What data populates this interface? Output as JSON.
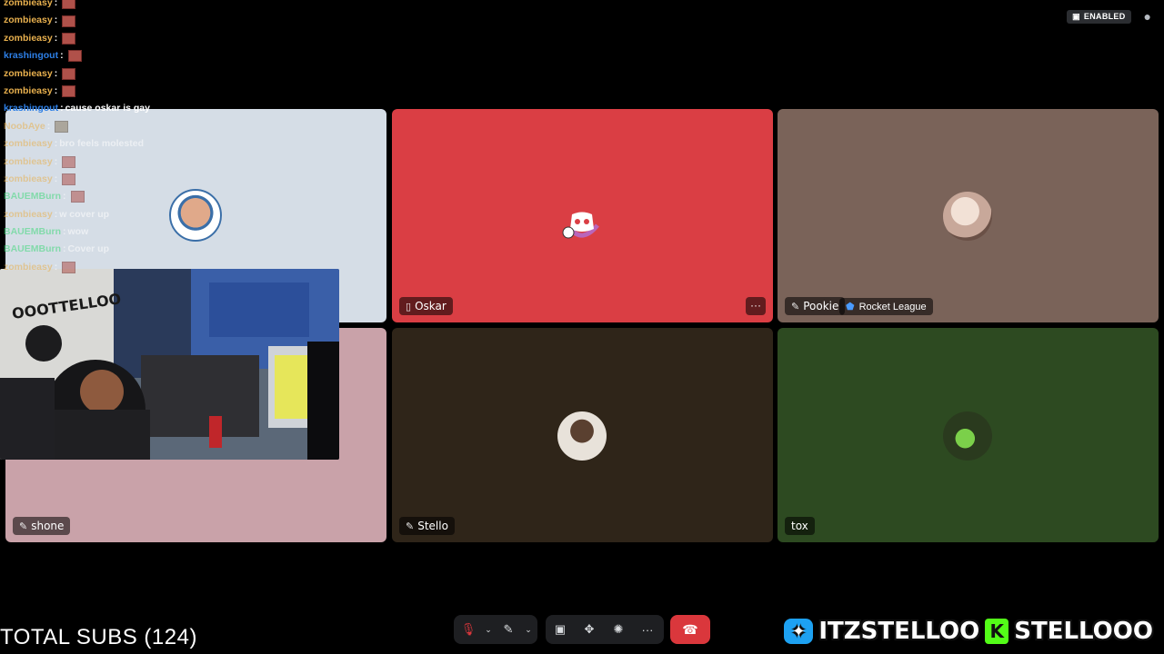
{
  "topbar": {
    "enabled_label": "ENABLED"
  },
  "chat": [
    {
      "user": "zombieasy",
      "sep": " : ",
      "msg": "",
      "emote": true,
      "color": "y",
      "dim": false
    },
    {
      "user": "zombieasy",
      "sep": " : ",
      "msg": "",
      "emote": true,
      "color": "y",
      "dim": false
    },
    {
      "user": "zombieasy",
      "sep": " : ",
      "msg": "",
      "emote": true,
      "color": "y",
      "dim": false
    },
    {
      "user": "krashingout",
      "sep": " : ",
      "msg": "",
      "emote": true,
      "color": "b",
      "dim": false
    },
    {
      "user": "zombieasy",
      "sep": " : ",
      "msg": "",
      "emote": true,
      "color": "y",
      "dim": false
    },
    {
      "user": "zombieasy",
      "sep": " : ",
      "msg": "",
      "emote": true,
      "color": "y",
      "dim": false
    },
    {
      "user": "krashingout",
      "sep": " : ",
      "msg": "cause oskar is gay",
      "emote": false,
      "color": "b",
      "dim": false
    },
    {
      "user": "NoobAye",
      "sep": " : ",
      "msg": "",
      "emote": true,
      "color": "y",
      "dim": true
    },
    {
      "user": "zombieasy",
      "sep": " : ",
      "msg": "bro feels molested",
      "emote": false,
      "color": "y",
      "dim": true
    },
    {
      "user": "zombieasy",
      "sep": " : ",
      "msg": "",
      "emote": true,
      "color": "y",
      "dim": true
    },
    {
      "user": "zombieasy",
      "sep": " : ",
      "msg": "",
      "emote": true,
      "color": "y",
      "dim": true
    },
    {
      "user": "BAUEMBurn",
      "sep": " : ",
      "msg": "",
      "emote": true,
      "color": "g",
      "dim": true
    },
    {
      "user": "zombieasy",
      "sep": " : ",
      "msg": "w cover up",
      "emote": false,
      "color": "y",
      "dim": true
    },
    {
      "user": "BAUEMBurn",
      "sep": " : ",
      "msg": "wow",
      "emote": false,
      "color": "g",
      "dim": true
    },
    {
      "user": "BAUEMBurn",
      "sep": " : ",
      "msg": "Cover up",
      "emote": false,
      "color": "g",
      "dim": true
    },
    {
      "user": "zombieasy",
      "sep": " : ",
      "msg": "",
      "emote": true,
      "color": "y",
      "dim": true
    }
  ],
  "tiles": {
    "shone": {
      "name": "shone",
      "bg": "#c9a2a9"
    },
    "oskar": {
      "name": "Oskar",
      "bg": "#da3e44"
    },
    "pookie": {
      "name": "Pookie",
      "activity": "Rocket League",
      "bg": "#7a6359"
    },
    "stello": {
      "name": "Stello",
      "bg": "#2f2519"
    },
    "tox": {
      "name": "tox",
      "bg": "#2d4a21"
    },
    "top_left": {
      "bg": "#d5dde6"
    }
  },
  "footer": {
    "subs": "TOTAL SUBS (124)",
    "twitter": "ITZSTELLOO",
    "kick": "STELLOOO"
  },
  "icons": {
    "more": "more-icon",
    "hangup": "phone-hangup-icon"
  }
}
